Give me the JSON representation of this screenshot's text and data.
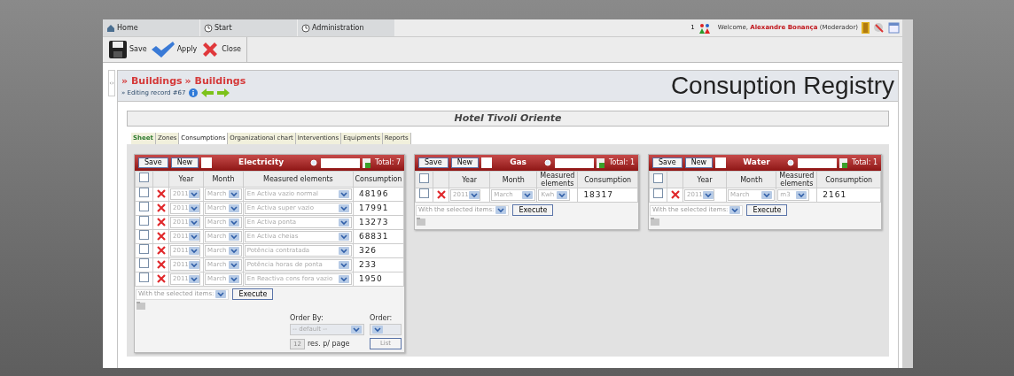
{
  "top_tabs": [
    {
      "label": "Home"
    },
    {
      "label": "Start"
    },
    {
      "label": "Administration"
    }
  ],
  "user": {
    "count": "1",
    "welcome": "Welcome,",
    "name": "Alexandre Bonança",
    "role": "(Moderador)"
  },
  "toolbar": [
    {
      "label": "Save",
      "kind": "save"
    },
    {
      "label": "Apply",
      "kind": "apply"
    },
    {
      "label": "Close",
      "kind": "close"
    }
  ],
  "sidebar_toggle": "‹›",
  "breadcrumb": [
    "» Buildings",
    "» Buildings"
  ],
  "editing": "» Editing record #67",
  "page_title": "Consuption Registry",
  "record_name": "Hotel Tivoli Oriente",
  "tabs": [
    {
      "label": "Sheet",
      "selected": false
    },
    {
      "label": "Zones",
      "selected": false
    },
    {
      "label": "Consumptions",
      "selected": true
    },
    {
      "label": "Organizational chart",
      "selected": false
    },
    {
      "label": "Interventions",
      "selected": false
    },
    {
      "label": "Equipments",
      "selected": false
    },
    {
      "label": "Reports",
      "selected": false
    }
  ],
  "panels": [
    {
      "title": "Electricity",
      "all_checked": false,
      "save": "Save",
      "new": "New",
      "total": "Total: 7",
      "columns": [
        "Year",
        "Month",
        "Measured elements",
        "Consumption"
      ],
      "rows": [
        {
          "checked": false,
          "year": "2011",
          "month": "March",
          "element": "En Activa vazio normal",
          "consumption": "48196"
        },
        {
          "checked": false,
          "year": "2011",
          "month": "March",
          "element": "En Activa super vazio",
          "consumption": "17991"
        },
        {
          "checked": false,
          "year": "2011",
          "month": "March",
          "element": "En Activa ponta",
          "consumption": "13273"
        },
        {
          "checked": false,
          "year": "2011",
          "month": "March",
          "element": "En Activa cheias",
          "consumption": "68831"
        },
        {
          "checked": false,
          "year": "2011",
          "month": "March",
          "element": "Potência contratada",
          "consumption": "326"
        },
        {
          "checked": false,
          "year": "2011",
          "month": "March",
          "element": "Potência horas de ponta",
          "consumption": "233"
        },
        {
          "checked": false,
          "year": "2011",
          "month": "March",
          "element": "En Reactiva cons fora vazio",
          "consumption": "1950"
        }
      ],
      "bulk": "With the selected items:",
      "execute": "Execute",
      "order": {
        "order_by_label": "Order By:",
        "order_by_value": "-- default --",
        "order_label": "Order:",
        "per_page": "12",
        "per_page_label": "res. p/ page",
        "list": "List"
      }
    },
    {
      "title": "Gas",
      "all_checked": false,
      "save": "Save",
      "new": "New",
      "total": "Total: 1",
      "columns": [
        "Year",
        "Month",
        "Measured elements",
        "Consumption"
      ],
      "rows": [
        {
          "checked": false,
          "year": "2011",
          "month": "March",
          "element": "Kwh",
          "consumption": "18317"
        }
      ],
      "bulk": "With the selected items:",
      "execute": "Execute"
    },
    {
      "title": "Water",
      "all_checked": false,
      "save": "Save",
      "new": "New",
      "total": "Total: 1",
      "columns": [
        "Year",
        "Month",
        "Measured elements",
        "Consumption"
      ],
      "rows": [
        {
          "checked": false,
          "year": "2011",
          "month": "March",
          "element": "m3",
          "consumption": "2161"
        }
      ],
      "bulk": "With the selected items:",
      "execute": "Execute"
    }
  ]
}
